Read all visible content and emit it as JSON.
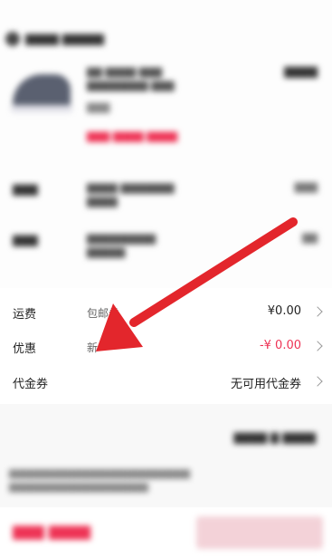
{
  "fees": {
    "shipping": {
      "label": "运费",
      "sub": "包邮券",
      "amount": "¥0.00"
    },
    "discount": {
      "label": "优惠",
      "sub": "新",
      "amount": "-¥ 0.00"
    },
    "voucher": {
      "label": "代金券",
      "amount": "无可用代金券"
    }
  },
  "colors": {
    "accent_red": "#ee3355",
    "arrow_red": "#e3262c"
  }
}
